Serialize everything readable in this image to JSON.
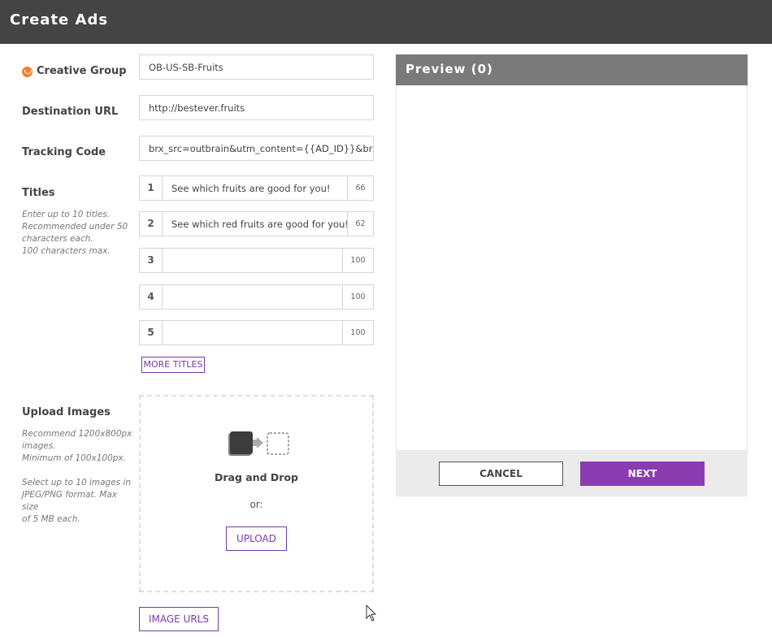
{
  "header": {
    "title": "Create Ads"
  },
  "creative_group": {
    "label": "Creative Group",
    "value": "OB-US-SB-Fruits",
    "icon": "warning-icon"
  },
  "destination_url": {
    "label": "Destination URL",
    "value": "http://bestever.fruits"
  },
  "tracking_code": {
    "label": "Tracking Code",
    "value": "brx_src=outbrain&utm_content={{AD_ID}}&brx_a"
  },
  "titles": {
    "label": "Titles",
    "hint": [
      "Enter up to 10 titles.",
      "Recommended under 50",
      "characters each.",
      "100 characters max."
    ],
    "rows": [
      {
        "num": "1",
        "text": "See which fruits are good for you!",
        "remaining": "66"
      },
      {
        "num": "2",
        "text": "See which red fruits are good for you!",
        "remaining": "62"
      },
      {
        "num": "3",
        "text": "",
        "remaining": "100"
      },
      {
        "num": "4",
        "text": "",
        "remaining": "100"
      },
      {
        "num": "5",
        "text": "",
        "remaining": "100"
      }
    ],
    "more_button": "MORE TITLES"
  },
  "upload_images": {
    "label": "Upload Images",
    "hint1": [
      "Recommend 1200x800px",
      "images.",
      "Minimum of 100x100px."
    ],
    "hint2": [
      "Select up to 10 images in",
      "JPEG/PNG format. Max size",
      "of 5 MB each."
    ],
    "dropzone_title": "Drag and Drop",
    "or_text": "or:",
    "upload_button": "UPLOAD",
    "image_urls_button": "IMAGE URLS"
  },
  "preview": {
    "title": "Preview (0)",
    "cancel_button": "CANCEL",
    "next_button": "NEXT"
  },
  "colors": {
    "header_bg": "#444444",
    "accent": "#8a3cb0",
    "preview_header": "#7a7a7a",
    "warning": "#f0812b"
  }
}
